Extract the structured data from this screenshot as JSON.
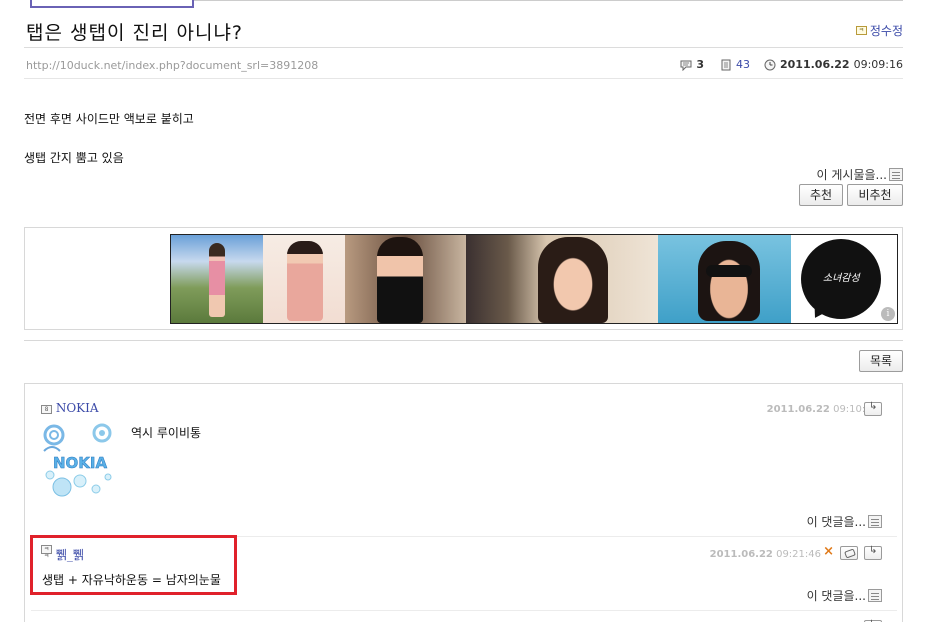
{
  "post": {
    "title": "탭은 생탭이 진리 아니냐?",
    "author": "정수정",
    "author_badge": "ㅋ",
    "url": "http://10duck.net/index.php?document_srl=3891208",
    "comment_count": "3",
    "read_count": "43",
    "date": "2011.06.22",
    "time": "09:09:16",
    "body_lines": [
      "전면 후면 사이드만 액보로 붙히고",
      "생탭 간지 뿜고 있음"
    ],
    "tools_label": "이 게시물을...",
    "recommend_label": "추천",
    "not_recommend_label": "비추천"
  },
  "ad": {
    "logo_text": "소녀감성",
    "info_glyph": "i"
  },
  "list_button": "목록",
  "comments": [
    {
      "author": "NOKIA",
      "badge": "8",
      "date": "2011.06.22",
      "time": "09:10:25",
      "text": "역시 루이비통",
      "tools_label": "이 댓글을..."
    },
    {
      "author": "쀍_쀍",
      "badge": "ㅋㅋ",
      "date": "2011.06.22",
      "time": "09:21:46",
      "text": "생탭 + 자유낙하운동 = 남자의눈물",
      "tools_label": "이 댓글을..."
    }
  ],
  "icons": {
    "comment": "speech-bubble-icon",
    "read": "document-icon",
    "clock": "clock-icon",
    "delete": "x-icon",
    "edit": "eraser-icon",
    "reply": "reply-arrow-icon",
    "tools": "list-icon"
  },
  "colors": {
    "link": "#3b4aa8",
    "highlight_box": "#e0212b",
    "delete_x": "#e07a1a"
  }
}
